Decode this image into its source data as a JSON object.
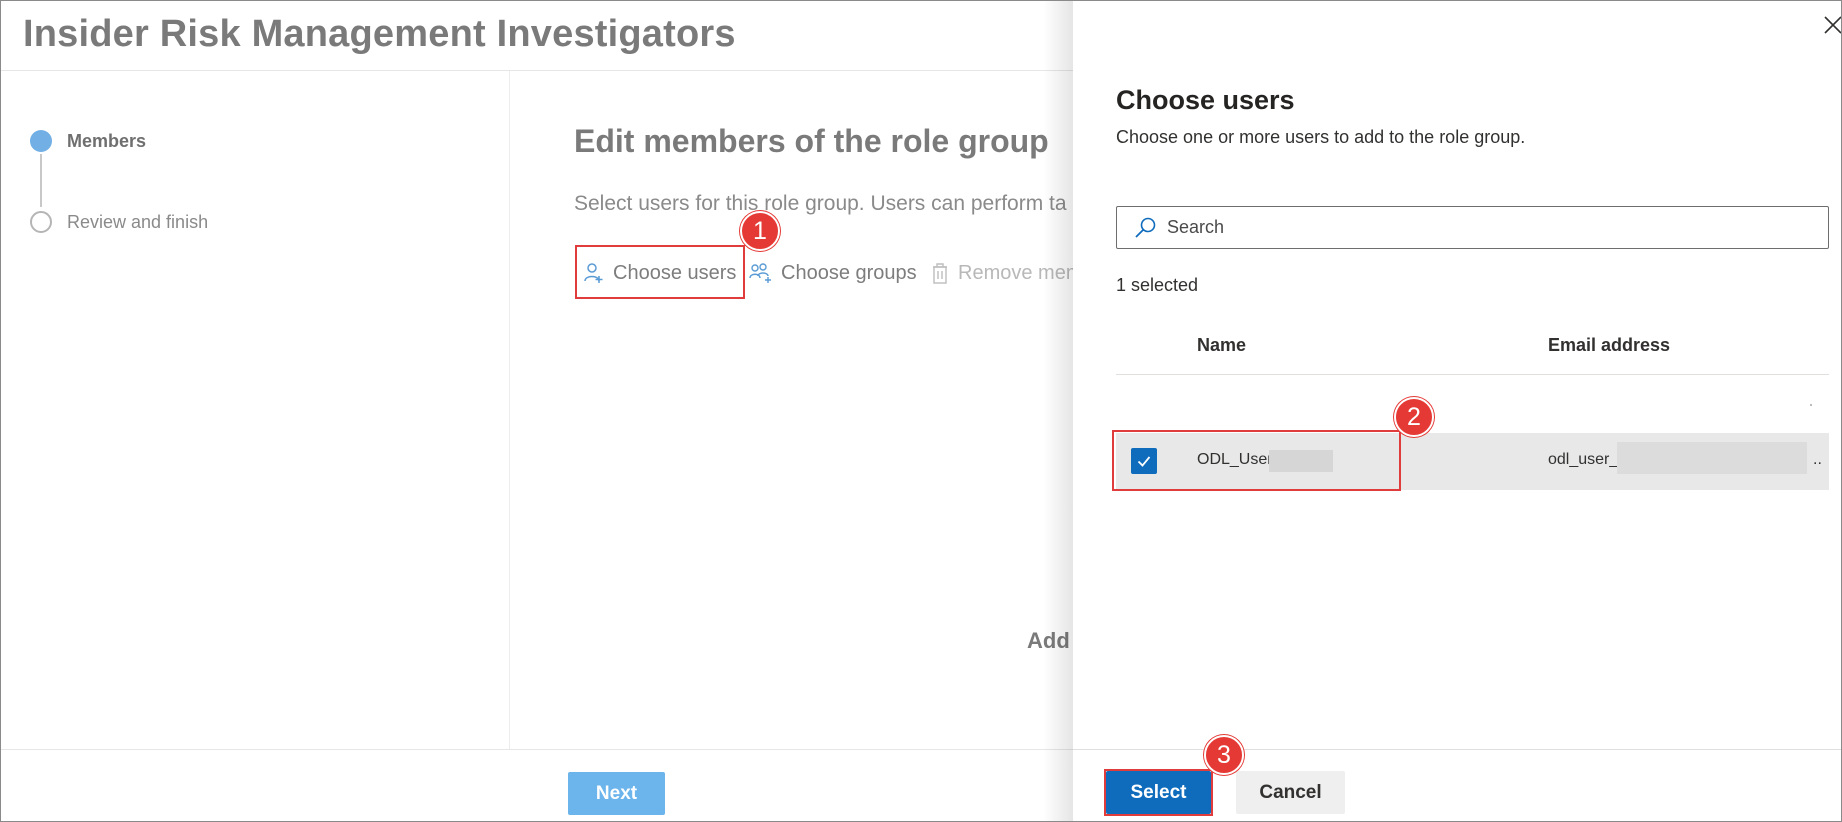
{
  "window": {
    "title": "Insider Risk Management Investigators"
  },
  "wizard": {
    "steps": [
      {
        "label": "Members",
        "state": "active"
      },
      {
        "label": "Review and finish",
        "state": "pending"
      }
    ],
    "heading": "Edit members of the role group",
    "description": "Select users for this role group. Users can perform ta",
    "commands": {
      "choose_users": "Choose users",
      "choose_groups": "Choose groups",
      "remove_members": "Remove mem"
    },
    "add_text": "Add",
    "next_label": "Next"
  },
  "panel": {
    "title": "Choose users",
    "subtitle": "Choose one or more users to add to the role group.",
    "search_placeholder": "Search",
    "selected_count": "1 selected",
    "columns": {
      "name": "Name",
      "email": "Email address"
    },
    "rows": [
      {
        "name": "ODL_User",
        "email": "odl_user_",
        "email_suffix": "..",
        "checked": true
      }
    ],
    "select_label": "Select",
    "cancel_label": "Cancel"
  },
  "callouts": [
    "1",
    "2",
    "3"
  ],
  "colors": {
    "accent": "#0f6cbd",
    "next_disabled": "#6cb4ec",
    "step_active": "#71afe5",
    "highlight": "#e03c3c",
    "badge": "#e53935"
  }
}
